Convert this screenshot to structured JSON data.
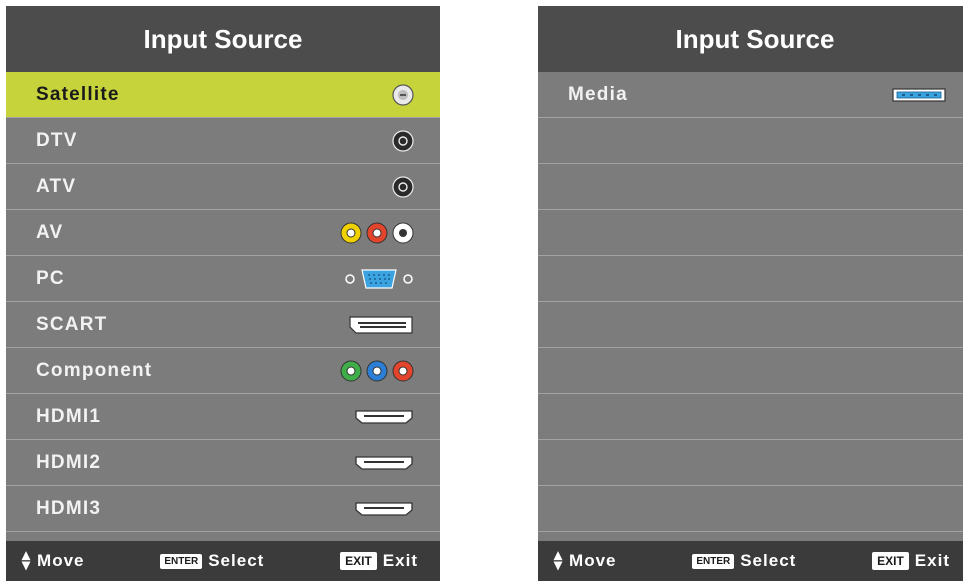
{
  "left": {
    "title": "Input Source",
    "items": [
      {
        "label": "Satellite",
        "icon": "satellite-connector-icon"
      },
      {
        "label": "DTV",
        "icon": "antenna-connector-icon"
      },
      {
        "label": "ATV",
        "icon": "antenna-connector-icon"
      },
      {
        "label": "AV",
        "icon": "av-rca-connector-icon"
      },
      {
        "label": "PC",
        "icon": "vga-connector-icon"
      },
      {
        "label": "SCART",
        "icon": "scart-connector-icon"
      },
      {
        "label": "Component",
        "icon": "component-rca-connector-icon"
      },
      {
        "label": "HDMI1",
        "icon": "hdmi-connector-icon"
      },
      {
        "label": "HDMI2",
        "icon": "hdmi-connector-icon"
      },
      {
        "label": "HDMI3",
        "icon": "hdmi-connector-icon"
      }
    ],
    "selected": "Satellite"
  },
  "right": {
    "title": "Input Source",
    "items": [
      {
        "label": "Media",
        "icon": "usb-connector-icon"
      }
    ]
  },
  "footer": {
    "move_label": "Move",
    "enter_key": "ENTER",
    "select_label": "Select",
    "exit_key": "EXIT",
    "exit_label": "Exit"
  },
  "colors": {
    "panel": "#7c7c7c",
    "title_bar": "#4c4c4c",
    "footer_bar": "#3b3b3b",
    "highlight": "#c7d33b"
  }
}
